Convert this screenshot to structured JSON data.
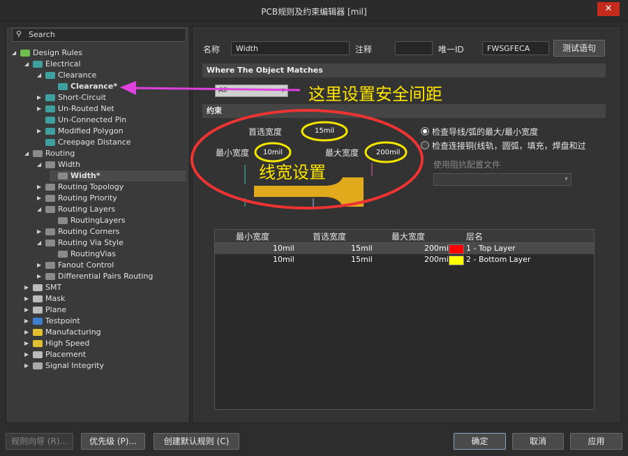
{
  "window": {
    "title": "PCB规则及约束编辑器 [mil]",
    "close_glyph": "✕"
  },
  "search": {
    "label": "Search"
  },
  "tree": [
    {
      "label": "Design Rules",
      "level": 0,
      "arrow": "◢",
      "icon": "rules"
    },
    {
      "label": "Electrical",
      "level": 1,
      "arrow": "◢",
      "icon": "folder"
    },
    {
      "label": "Clearance",
      "level": 2,
      "arrow": "◢",
      "icon": "rule"
    },
    {
      "label": "Clearance*",
      "level": 3,
      "arrow": "",
      "icon": "rule",
      "bold": true
    },
    {
      "label": "Short-Circuit",
      "level": 2,
      "arrow": "▶",
      "icon": "rule"
    },
    {
      "label": "Un-Routed Net",
      "level": 2,
      "arrow": "▶",
      "icon": "rule"
    },
    {
      "label": "Un-Connected Pin",
      "level": 2,
      "arrow": "",
      "icon": "rule"
    },
    {
      "label": "Modified Polygon",
      "level": 2,
      "arrow": "▶",
      "icon": "rule"
    },
    {
      "label": "Creepage Distance",
      "level": 2,
      "arrow": "",
      "icon": "rule"
    },
    {
      "label": "Routing",
      "level": 1,
      "arrow": "◢",
      "icon": "route"
    },
    {
      "label": "Width",
      "level": 2,
      "arrow": "◢",
      "icon": "route"
    },
    {
      "label": "Width*",
      "level": 3,
      "arrow": "",
      "icon": "route",
      "bold": true,
      "selected": true
    },
    {
      "label": "Routing Topology",
      "level": 2,
      "arrow": "▶",
      "icon": "route"
    },
    {
      "label": "Routing Priority",
      "level": 2,
      "arrow": "▶",
      "icon": "route"
    },
    {
      "label": "Routing Layers",
      "level": 2,
      "arrow": "◢",
      "icon": "route"
    },
    {
      "label": "RoutingLayers",
      "level": 3,
      "arrow": "",
      "icon": "route"
    },
    {
      "label": "Routing Corners",
      "level": 2,
      "arrow": "▶",
      "icon": "route"
    },
    {
      "label": "Routing Via Style",
      "level": 2,
      "arrow": "◢",
      "icon": "route"
    },
    {
      "label": "RoutingVias",
      "level": 3,
      "arrow": "",
      "icon": "route"
    },
    {
      "label": "Fanout Control",
      "level": 2,
      "arrow": "▶",
      "icon": "route"
    },
    {
      "label": "Differential Pairs Routing",
      "level": 2,
      "arrow": "▶",
      "icon": "route"
    },
    {
      "label": "SMT",
      "level": 1,
      "arrow": "▶",
      "icon": "smt"
    },
    {
      "label": "Mask",
      "level": 1,
      "arrow": "▶",
      "icon": "mask"
    },
    {
      "label": "Plane",
      "level": 1,
      "arrow": "▶",
      "icon": "plane"
    },
    {
      "label": "Testpoint",
      "level": 1,
      "arrow": "▶",
      "icon": "testpoint"
    },
    {
      "label": "Manufacturing",
      "level": 1,
      "arrow": "▶",
      "icon": "manufacturing"
    },
    {
      "label": "High Speed",
      "level": 1,
      "arrow": "▶",
      "icon": "highspeed"
    },
    {
      "label": "Placement",
      "level": 1,
      "arrow": "▶",
      "icon": "placement"
    },
    {
      "label": "Signal Integrity",
      "level": 1,
      "arrow": "▶",
      "icon": "signal"
    }
  ],
  "header": {
    "name_label": "名称",
    "name_value": "Width",
    "comment_label": "注释",
    "comment_value": "",
    "uid_label": "唯一ID",
    "uid_value": "FWSGFECA",
    "test_button": "测试语句"
  },
  "where": {
    "title": "Where The Object Matches",
    "dropdown_value": "All"
  },
  "constraints": {
    "title": "约束",
    "preferred_label": "首选宽度",
    "preferred_value": "15mil",
    "min_label": "最小宽度",
    "min_value": "10mil",
    "max_label": "最大宽度",
    "max_value": "200mil",
    "radio1": "检查导线/弧的最大/最小宽度",
    "radio2": "检查连接铜(线轨，圆弧，填充，焊盘和过",
    "impedance_label": "使用阻抗配置文件"
  },
  "table": {
    "headers": [
      "最小宽度",
      "首选宽度",
      "最大宽度",
      "层名"
    ],
    "rows": [
      {
        "min": "10mil",
        "pref": "15mil",
        "max": "200mil",
        "color": "#ff0000",
        "layer": "1 - Top Layer"
      },
      {
        "min": "10mil",
        "pref": "15mil",
        "max": "200mil",
        "color": "#ffff00",
        "layer": "2 - Bottom Layer"
      }
    ]
  },
  "annotations": {
    "clearance_note": "这里设置安全间距",
    "width_note": "线宽设置",
    "colors": {
      "arrow": "#e040e0",
      "ellipse_big": "#ee3333",
      "ellipse_small": "#f5e600",
      "note": "#ffe600",
      "trace": "#e0aa1c"
    }
  },
  "bottom": {
    "wizard": "规则向导 (R)...",
    "priority": "优先级 (P)...",
    "defaults": "创建默认规则 (C)",
    "ok": "确定",
    "cancel": "取消",
    "apply": "应用"
  }
}
